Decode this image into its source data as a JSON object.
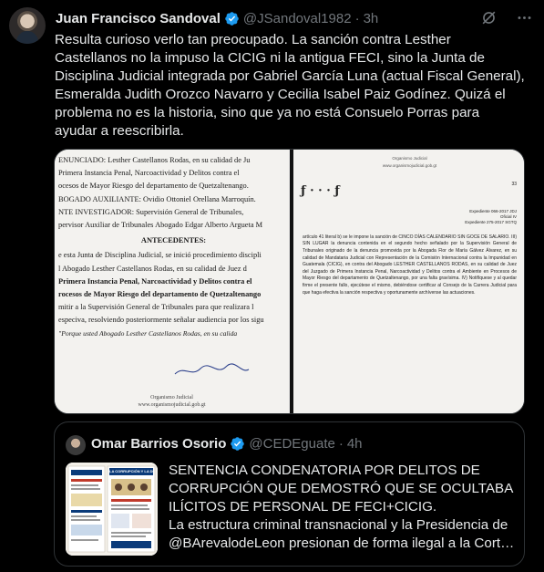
{
  "tweet": {
    "author_name": "Juan Francisco Sandoval",
    "handle": "@JSandoval1982",
    "separator": "·",
    "time": "3h",
    "text_lines": [
      "Resulta curioso verlo tan preocupado. La sanción contra Lesther",
      "Castellanos no la impuso la CICIG ni la antigua FECI, sino la Junta de",
      "Disciplina Judicial integrada por Gabriel García Luna (actual Fiscal General),",
      "Esmeralda Judith Orozco Navarro y Cecilia Isabel Paiz Godínez. Quizá el",
      "problema no es la historia, sino que ya no está Consuelo Porras para",
      "ayudar a reescribirla."
    ],
    "icons": [
      "verified-badge-icon",
      "grok-icon",
      "more-icon"
    ]
  },
  "document_left": {
    "lines": [
      {
        "t": "ENUNCIADO: Lesther Castellanos Rodas, en su calidad de Ju",
        "b": false
      },
      {
        "t": "Primera Instancia Penal, Narcoactividad y Delitos contra el",
        "b": false
      },
      {
        "t": "ocesos de Mayor Riesgo del departamento de Quetzaltenango.",
        "b": false
      },
      {
        "t": "BOGADO AUXILIANTE: Ovidio Ottoniel Orellana Marroquín.",
        "b": false
      },
      {
        "t": "NTE INVESTIGADOR: Supervisión General de Tribunales,",
        "b": false
      },
      {
        "t": "pervisor Auxiliar de Tribunales Abogado Edgar Alberto Argueta M",
        "b": false
      }
    ],
    "heading": "ANTECEDENTES:",
    "lines2": [
      "e esta Junta de Disciplina Judicial, se inició procedimiento discipli",
      "l Abogado Lesther Castellanos Rodas, en su calidad de Juez d",
      "Primera Instancia Penal, Narcoactividad y Delitos contra el",
      "rocesos de Mayor Riesgo del departamento de Quetzaltenango",
      "mitir a la Supervisión General de Tribunales para que realizara l",
      "especiva, resolviendo posteriormente señalar audiencia por los sigu"
    ],
    "quote_line": "\"Porque usted Abogado Lesther Castellanos Rodas, en su calida",
    "footer": [
      "Organismo Judicial",
      "www.organismojudicial.gob.gt"
    ]
  },
  "document_right": {
    "header": [
      "Organismo Judicial",
      "www.organismojudicial.gob.gt"
    ],
    "page_num": "33",
    "handwritten": "ƒ · · · ƒ",
    "expediente": [
      "Expediente 066-2017 JDJ",
      "Oficial IV",
      "Expediente 275-2017 SGTQ"
    ],
    "paragraphs": [
      "artículo 41 literal b) se le impone la sanción de CINCO DÍAS CALENDARIO SIN GOCE DE SALARIO. III) SIN LUGAR la denuncia contenida en el segundo hecho señalado por la Supervisión General de Tribunales originado de la denuncia promovida por la Abogada Flor de María Gálvez Álvarez, en su calidad de Mandataria Judicial con Representación de la Comisión Internacional contra la Impunidad en Guatemala (CICIG), en contra del Abogado LESTHER CASTELLANOS RODAS, en su calidad de Juez del Juzgado de Primera Instancia Penal, Narcoactividad y Delitos contra el Ambiente en Procesos de Mayor Riesgo del departamento de Quetzaltenango, por una falta gravísima. IV) Notifíquese y al quedar firme el presente fallo, ejecútese el mismo, debiéndose certificar al Consejo de la Carrera Judicial para que haga efectiva la sanción respectiva y oportunamente archívense las actuaciones."
    ]
  },
  "quote": {
    "author_name": "Omar Barrios Osorio",
    "handle": "@CEDEguate",
    "separator": "·",
    "time": "4h",
    "thumb_title": "LA CORRUPCIÓN Y LA DECISIÓN",
    "text_lines": [
      "SENTENCIA CONDENATORIA POR DELITOS DE",
      "CORRUPCIÓN QUE DEMOSTRÓ QUE SE OCULTABA",
      "ILÍCITOS DE PERSONAL DE FECI+CICIG.",
      "La estructura criminal transnacional y la Presidencia de",
      "@BArevalodeLeon presionan de forma ilegal a la Cort…"
    ]
  },
  "colors": {
    "background": "#000000",
    "text": "#e7e9ea",
    "muted": "#71767b",
    "border": "#2f3336",
    "verified": "#1d9bf0"
  }
}
